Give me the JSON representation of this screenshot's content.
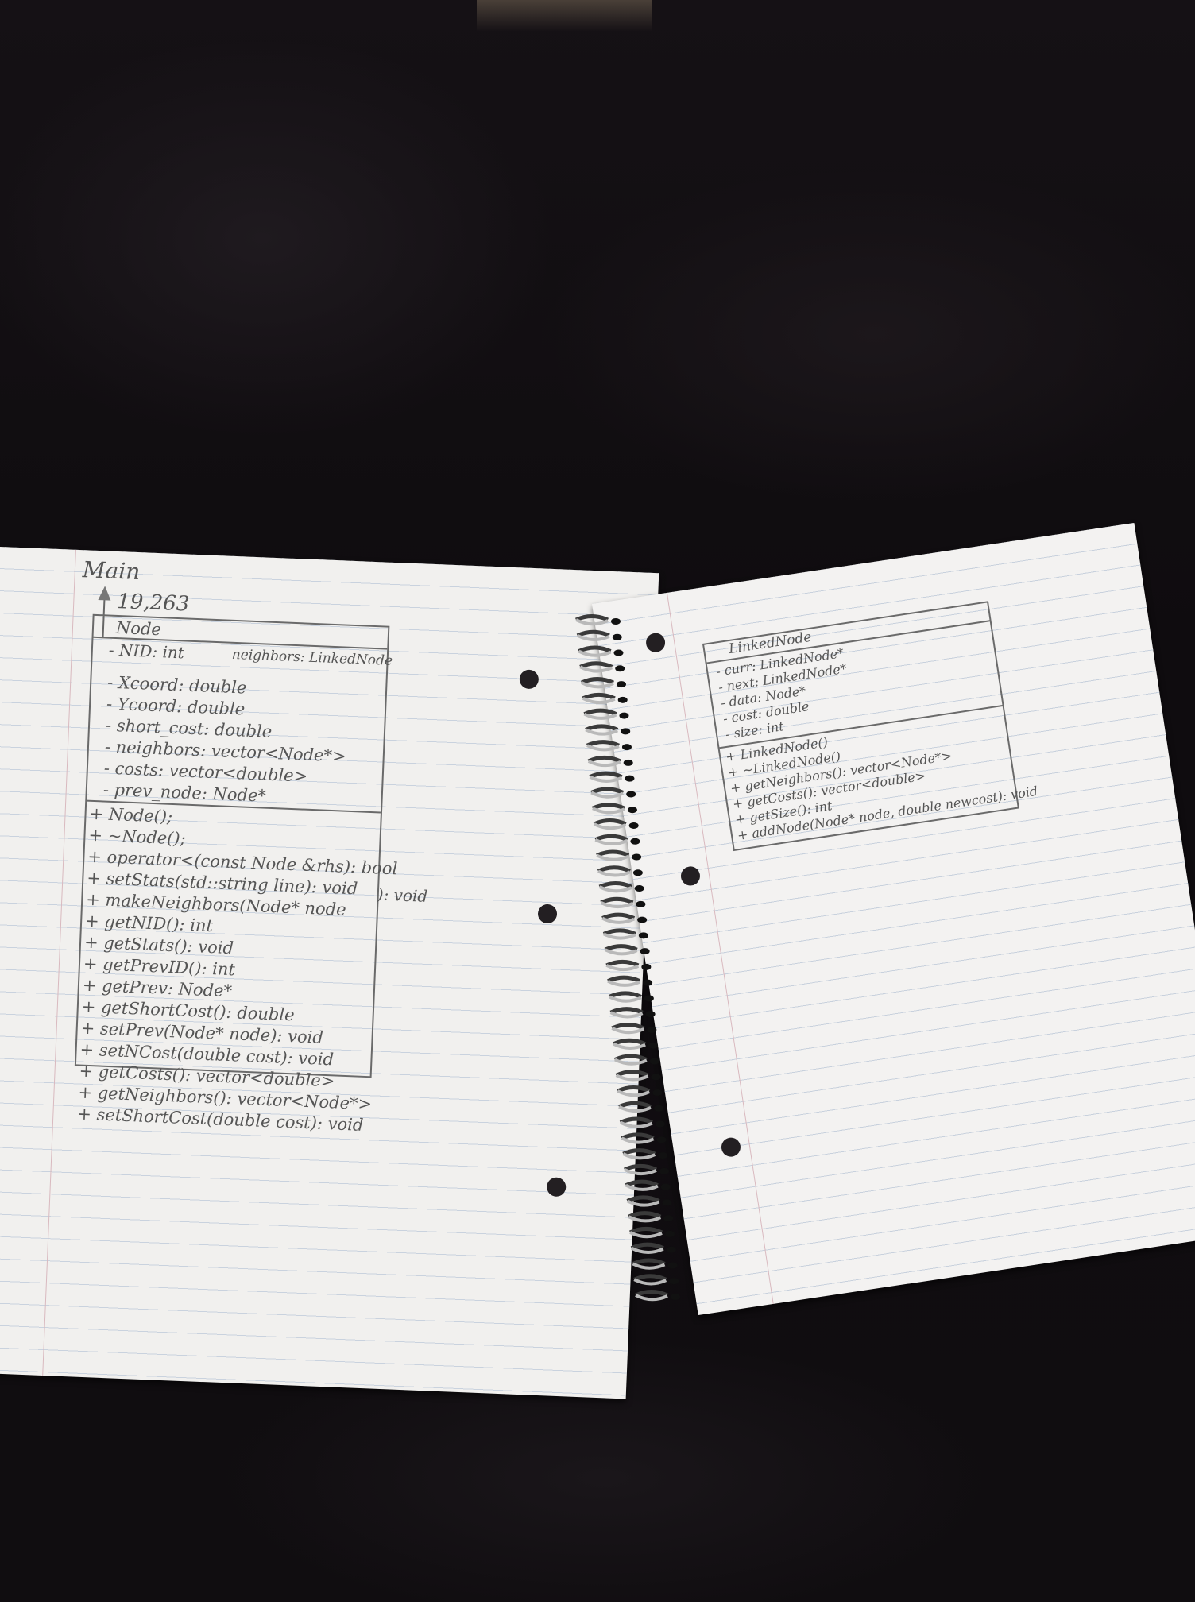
{
  "left_page": {
    "title": "Main",
    "number": "19,263",
    "class_name": "Node",
    "attr_row": "- NID: int",
    "attr_row_right": "neighbors: LinkedNode",
    "attributes": [
      "- Xcoord: double",
      "- Ycoord: double",
      "- short_cost: double",
      "- neighbors: vector<Node*>",
      "- costs: vector<double>",
      "- prev_node: Node*"
    ],
    "methods": [
      "+ Node();",
      "+ ~Node();",
      "+ operator<(const Node &rhs): bool",
      "+ setStats(std::string line): void",
      "+ makeNeighbors(Node* node",
      "+ getNID(): int",
      "+ getStats(): void",
      "+ getPrevID(): int",
      "+ getPrev: Node*",
      "+ getShortCost(): double",
      "+ setPrev(Node* node): void",
      "+ setNCost(double cost): void",
      "+ getCosts(): vector<double>",
      "+ getNeighbors(): vector<Node*>",
      "+ setShortCost(double cost): void"
    ],
    "make_neighbors_suffix": "): void"
  },
  "right_page": {
    "class_name": "LinkedNode",
    "attributes": [
      "- curr: LinkedNode*",
      "- next: LinkedNode*",
      "- data: Node*",
      "- cost: double",
      "- size: int"
    ],
    "methods": [
      "+ LinkedNode()",
      "+ ~LinkedNode()",
      "+ getNeighbors(): vector<Node*>",
      "+ getCosts(): vector<double>",
      "+ getSize(): int",
      "+ addNode(Node* node, double newcost): void"
    ]
  }
}
